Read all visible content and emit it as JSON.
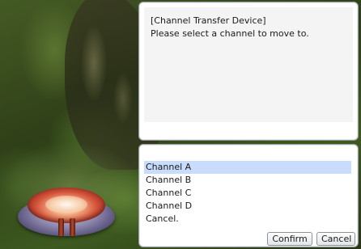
{
  "dialog": {
    "lines": [
      "[Channel Transfer Device]",
      "Please select a channel to move to."
    ]
  },
  "menu": {
    "items": [
      {
        "label": "Channel A",
        "selected": true
      },
      {
        "label": "Channel B",
        "selected": false
      },
      {
        "label": "Channel C",
        "selected": false
      },
      {
        "label": "Channel D",
        "selected": false
      },
      {
        "label": "Cancel.",
        "selected": false
      }
    ]
  },
  "buttons": {
    "confirm_label": "Confirm",
    "cancel_label": "Cancel"
  },
  "colors": {
    "selection_highlight": "#c9dcfb",
    "panel_bg": "#ffffff",
    "dialog_inner_bg": "#f4f4f4"
  }
}
